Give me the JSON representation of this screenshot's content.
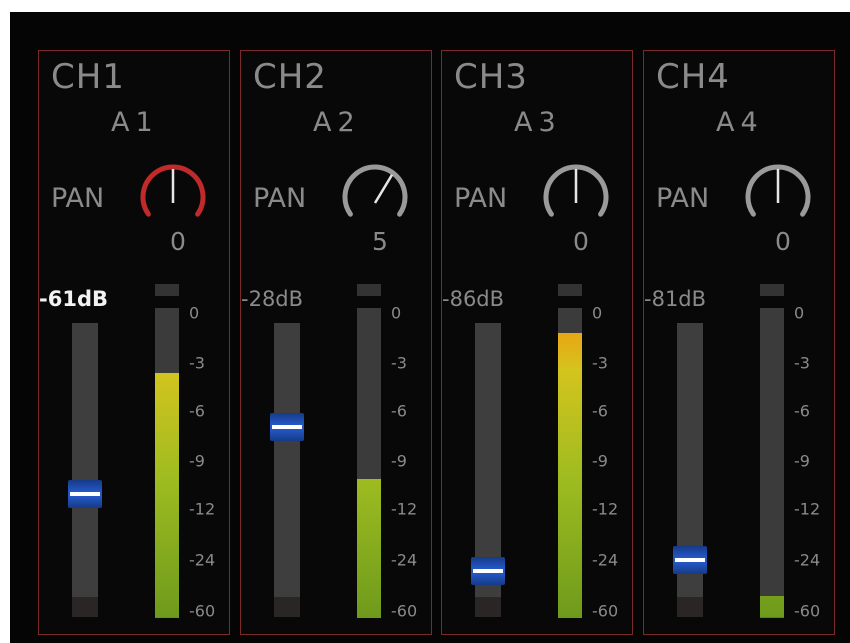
{
  "channels": [
    {
      "name": "CH1",
      "assign": "A1",
      "pan_label": "PAN",
      "pan_value": "0",
      "pan_position": 0,
      "pan_active": true,
      "level_label": "-61dB",
      "level_selected": true,
      "fader_position": 0.41,
      "meter_level": 0.79
    },
    {
      "name": "CH2",
      "assign": "A2",
      "pan_label": "PAN",
      "pan_value": "5",
      "pan_position": 0.3,
      "pan_active": false,
      "level_label": "-28dB",
      "level_selected": false,
      "fader_position": 0.66,
      "meter_level": 0.45
    },
    {
      "name": "CH3",
      "assign": "A3",
      "pan_label": "PAN",
      "pan_value": "0",
      "pan_position": 0,
      "pan_active": false,
      "level_label": "-86dB",
      "level_selected": false,
      "fader_position": 0.12,
      "meter_level": 0.92
    },
    {
      "name": "CH4",
      "assign": "A4",
      "pan_label": "PAN",
      "pan_value": "0",
      "pan_position": 0,
      "pan_active": false,
      "level_label": "-81dB",
      "level_selected": false,
      "fader_position": 0.16,
      "meter_level": 0.07
    }
  ],
  "meter_scale": [
    "0",
    "-3",
    "-6",
    "-9",
    "-12",
    "-24",
    "-60"
  ],
  "colors": {
    "strip_border": "#7a2a2a",
    "knob_active": "#c02a2a",
    "knob_idle": "#9a9a9a",
    "fader_cap": "#2456c4",
    "meter_green": "#7ea51c",
    "meter_yellow": "#d4c41e",
    "meter_orange": "#ee6a12"
  }
}
